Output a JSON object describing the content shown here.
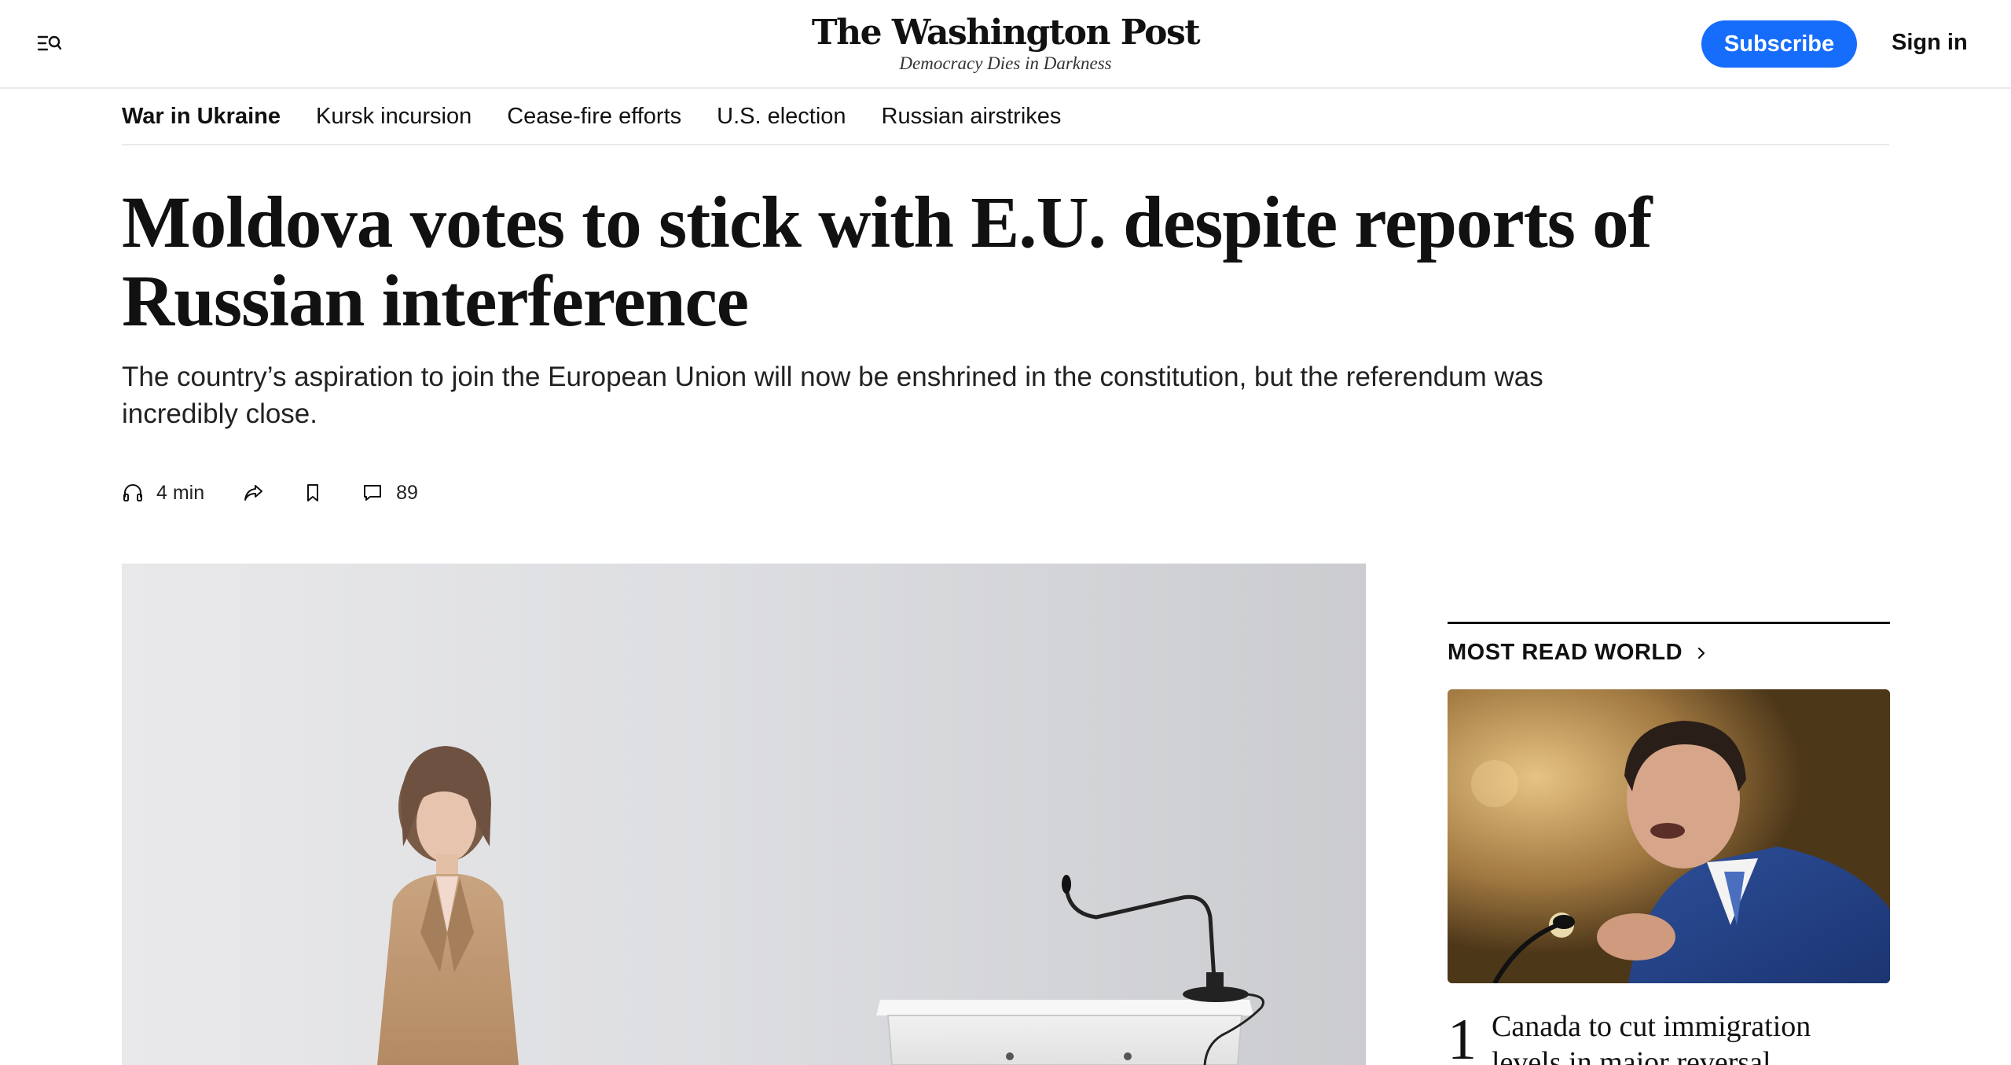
{
  "header": {
    "brand": "The Washington Post",
    "tagline": "Democracy Dies in Darkness",
    "menu_icon": "menu-search-icon",
    "subscribe_label": "Subscribe",
    "signin_label": "Sign in",
    "accent_color": "#166dfc"
  },
  "section_nav": {
    "items": [
      {
        "label": "War in Ukraine",
        "active": true
      },
      {
        "label": "Kursk incursion"
      },
      {
        "label": "Cease-fire efforts"
      },
      {
        "label": "U.S. election"
      },
      {
        "label": "Russian airstrikes"
      }
    ]
  },
  "article": {
    "headline": "Moldova votes to stick with E.U. despite reports of Russian interference",
    "dek": "The country’s aspiration to join the European Union will now be enshrined in the constitution, but the referendum was incredibly close.",
    "utility": {
      "listen_icon": "headphones-icon",
      "listen_duration": "4 min",
      "share_icon": "share-icon",
      "save_icon": "bookmark-icon",
      "comments_icon": "comment-icon",
      "comments_count": "89"
    },
    "lead_image_alt": "A woman in a tan blazer walks toward a clear lectern with a microphone"
  },
  "sidebar": {
    "most_read": {
      "title": "MOST READ WORLD",
      "chevron_icon": "chevron-right-icon",
      "image_alt": "A man in a blue suit speaking at a microphone",
      "items": [
        {
          "rank": "1",
          "headline": "Canada to cut immigration levels in major reversal"
        }
      ]
    }
  }
}
